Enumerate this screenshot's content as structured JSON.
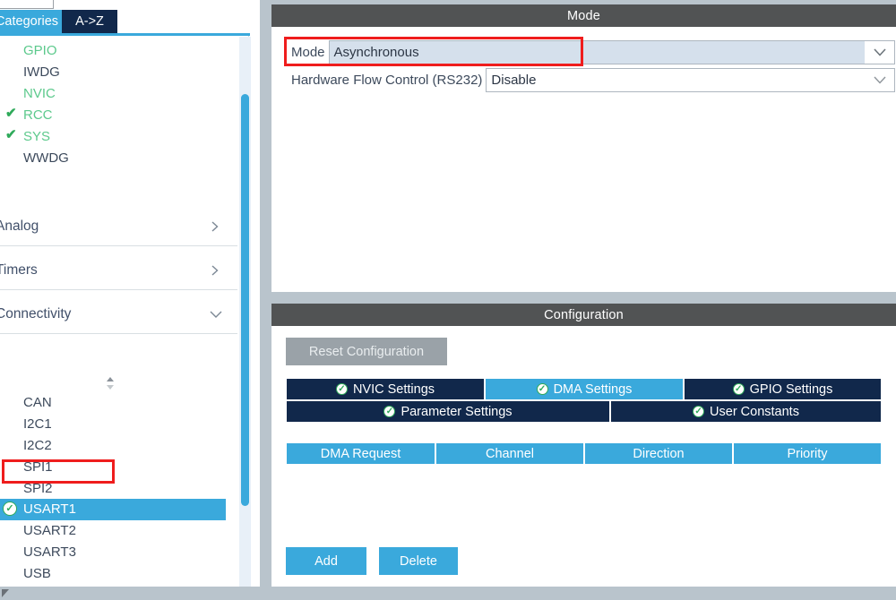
{
  "left_panel": {
    "search": {
      "value": "",
      "placeholder": ""
    },
    "tabs": [
      {
        "label": "Categories",
        "active": true
      },
      {
        "label": "A->Z",
        "active": false
      }
    ],
    "system_peripherals": [
      {
        "label": "GPIO",
        "checked": false,
        "green": true
      },
      {
        "label": "IWDG",
        "checked": false,
        "green": false
      },
      {
        "label": "NVIC",
        "checked": false,
        "green": true
      },
      {
        "label": "RCC",
        "checked": true,
        "green": true
      },
      {
        "label": "SYS",
        "checked": true,
        "green": true
      },
      {
        "label": "WWDG",
        "checked": false,
        "green": false
      }
    ],
    "categories": [
      {
        "label": "Analog",
        "expanded": false,
        "chevron": "chevron-right-icon"
      },
      {
        "label": "Timers",
        "expanded": false,
        "chevron": "chevron-right-icon"
      },
      {
        "label": "Connectivity",
        "expanded": true,
        "chevron": "chevron-down-icon"
      }
    ],
    "connectivity_items": [
      {
        "label": "CAN",
        "selected": false,
        "configured": false
      },
      {
        "label": "I2C1",
        "selected": false,
        "configured": false
      },
      {
        "label": "I2C2",
        "selected": false,
        "configured": false
      },
      {
        "label": "SPI1",
        "selected": false,
        "configured": false
      },
      {
        "label": "SPI2",
        "selected": false,
        "configured": false
      },
      {
        "label": "USART1",
        "selected": true,
        "configured": true
      },
      {
        "label": "USART2",
        "selected": false,
        "configured": false
      },
      {
        "label": "USART3",
        "selected": false,
        "configured": false
      },
      {
        "label": "USB",
        "selected": false,
        "configured": false
      }
    ],
    "scrollbar": {
      "name": "vertical-scrollbar"
    }
  },
  "mode_panel": {
    "title": "Mode",
    "rows": [
      {
        "label": "Mode",
        "value": "Asynchronous",
        "highlighted": true
      },
      {
        "label": "Hardware Flow Control (RS232)",
        "value": "Disable",
        "highlighted": false
      }
    ]
  },
  "configuration_panel": {
    "title": "Configuration",
    "reset_label": "Reset Configuration",
    "tabs_row1": [
      {
        "label": "NVIC Settings",
        "active": false,
        "checked": true
      },
      {
        "label": "DMA Settings",
        "active": true,
        "checked": true
      },
      {
        "label": "GPIO Settings",
        "active": false,
        "checked": true
      }
    ],
    "tabs_row2": [
      {
        "label": "Parameter Settings",
        "active": false,
        "checked": true
      },
      {
        "label": "User Constants",
        "active": false,
        "checked": true
      }
    ],
    "table": {
      "columns": [
        "DMA Request",
        "Channel",
        "Direction",
        "Priority"
      ],
      "rows": []
    },
    "buttons": [
      {
        "label": "Add"
      },
      {
        "label": "Delete"
      }
    ]
  },
  "annotations": {
    "mode_field_box": "red-highlight-rectangle",
    "usart1_box": "red-highlight-rectangle"
  },
  "icons": {
    "check": "✔",
    "tick": "✓"
  },
  "colors": {
    "accent_blue": "#3aa9dc",
    "dark_navy": "#11284b",
    "header_gray": "#515354",
    "green": "#2faa5a",
    "annotation_red": "#ef1d1d",
    "field_fill": "#d5e0ec"
  }
}
